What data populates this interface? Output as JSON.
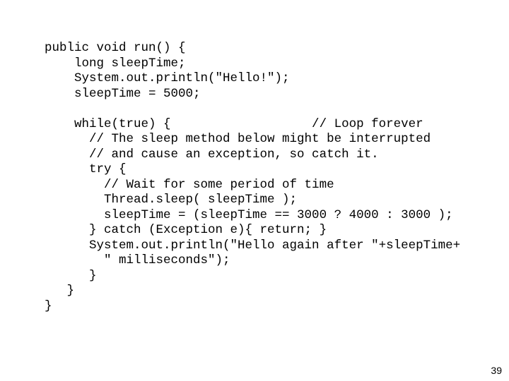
{
  "slide": {
    "page_number": "39",
    "background_color": "#ffffff",
    "text_color": "#000000",
    "language": "java"
  },
  "code": {
    "lines": [
      "public void run() {",
      "    long sleepTime;",
      "    System.out.println(\"Hello!\");",
      "    sleepTime = 5000;",
      "",
      "    while(true) {                   // Loop forever",
      "      // The sleep method below might be interrupted",
      "      // and cause an exception, so catch it.",
      "      try {",
      "        // Wait for some period of time",
      "        Thread.sleep( sleepTime );",
      "        sleepTime = (sleepTime == 3000 ? 4000 : 3000 );",
      "      } catch (Exception e){ return; }",
      "      System.out.println(\"Hello again after \"+sleepTime+",
      "        \" milliseconds\");",
      "      }",
      "   }",
      "}"
    ]
  }
}
